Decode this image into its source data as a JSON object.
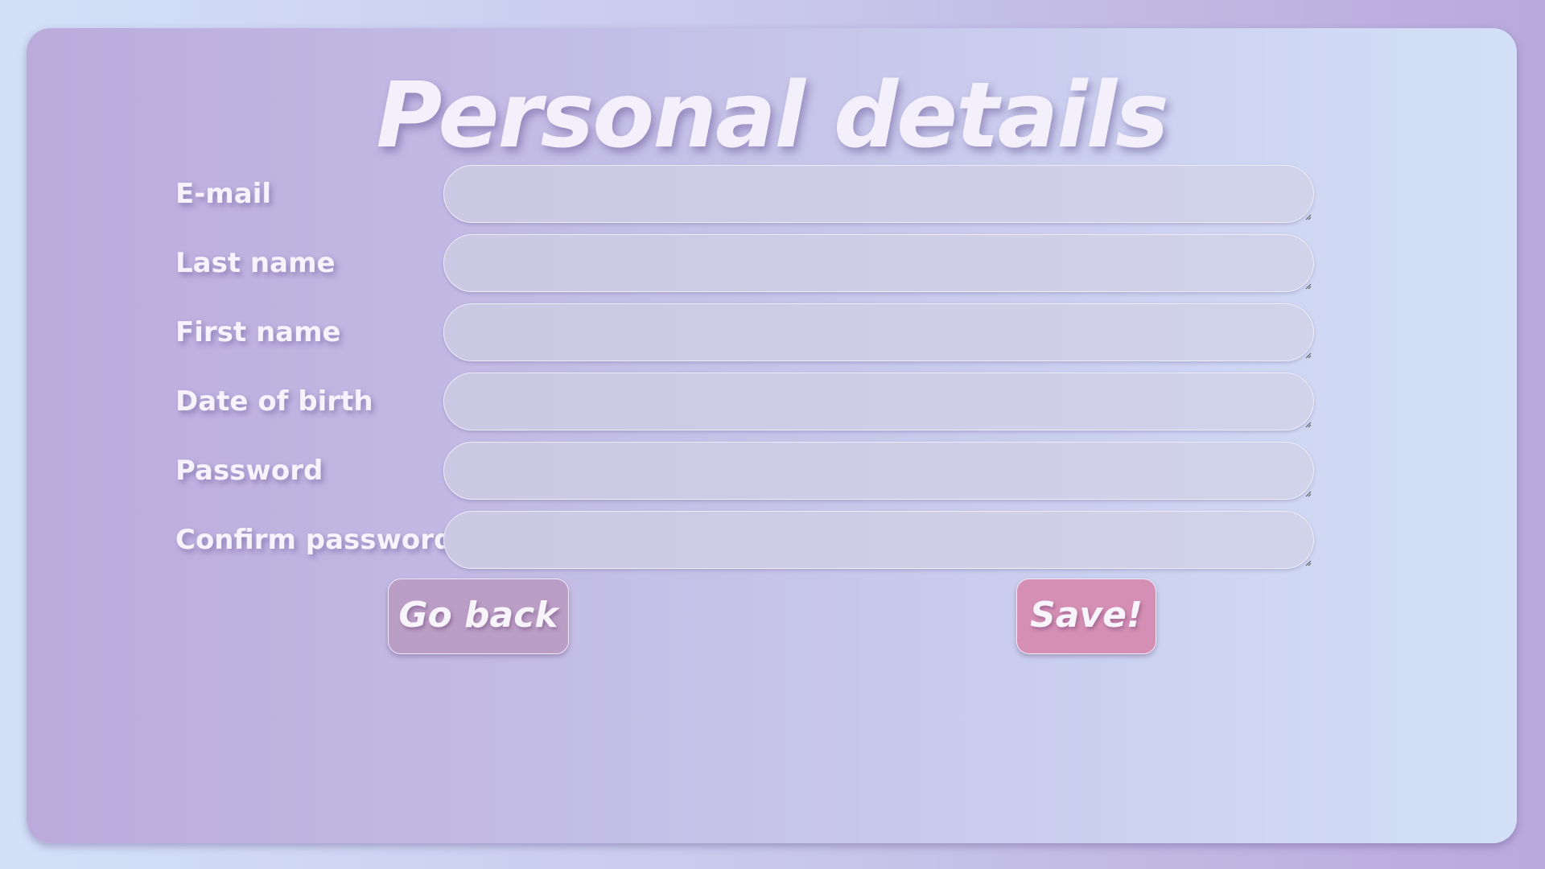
{
  "page": {
    "title": "Personal details"
  },
  "form": {
    "fields": [
      {
        "label": "E-mail",
        "value": ""
      },
      {
        "label": "Last name",
        "value": ""
      },
      {
        "label": "First name",
        "value": ""
      },
      {
        "label": "Date of birth",
        "value": ""
      },
      {
        "label": "Password",
        "value": ""
      },
      {
        "label": "Confirm password",
        "value": ""
      }
    ]
  },
  "actions": {
    "back_label": "Go back",
    "save_label": "Save!"
  },
  "colors": {
    "back_button": "#bb9ec6",
    "save_button": "#d68fb4",
    "text": "#f6f3fc"
  },
  "icons": {
    "field_corner": "resize-handle-icon"
  }
}
